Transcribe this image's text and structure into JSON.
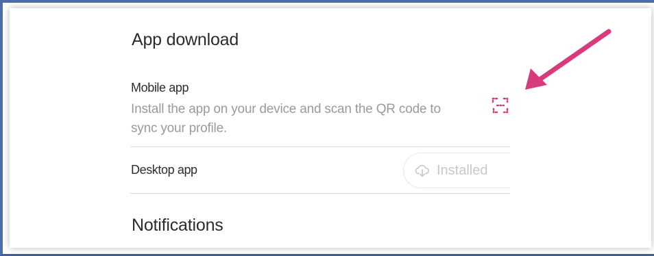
{
  "sections": {
    "app_download_title": "App download",
    "notifications_title": "Notifications"
  },
  "mobile_app": {
    "label": "Mobile app",
    "description": "Install the app on your device and scan the QR code to sync your profile.",
    "qr_icon": "qr-scan-icon"
  },
  "desktop_app": {
    "label": "Desktop app",
    "button_label": "Installed",
    "button_icon": "cloud-download-icon"
  },
  "annotation": {
    "arrow_icon": "arrow-pointer-icon"
  },
  "colors": {
    "accent": "#d83a7c",
    "frame_border": "#4a6ea8",
    "muted_text": "#9a9a9a",
    "disabled_text": "#c8c8c8",
    "divider": "#d9d9d9"
  }
}
